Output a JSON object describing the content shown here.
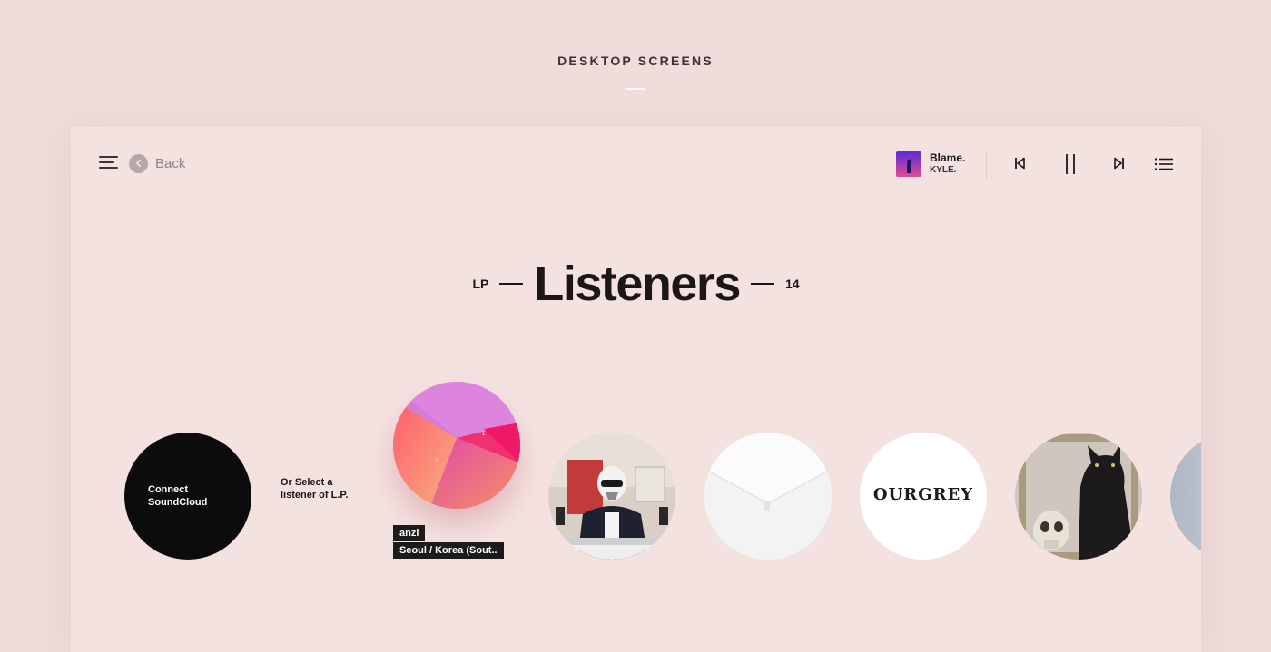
{
  "page": {
    "heading": "DESKTOP SCREENS"
  },
  "topbar": {
    "back_label": "Back",
    "now_playing": {
      "title": "Blame.",
      "artist": "KYLE."
    }
  },
  "title": {
    "prefix": "LP",
    "main": "Listeners",
    "count": "14"
  },
  "connect": {
    "label": "Connect SoundCloud"
  },
  "select_hint": "Or Select a listener of L.P.",
  "featured": {
    "name": "anzi",
    "location": "Seoul / Korea (Sout..",
    "chart_numbers": [
      "1",
      "2"
    ]
  },
  "listeners": [
    {
      "kind": "photo-stormtrooper"
    },
    {
      "kind": "white-abstract"
    },
    {
      "kind": "logo",
      "text": "OURGREY"
    },
    {
      "kind": "photo-cat"
    },
    {
      "kind": "partial"
    }
  ],
  "colors": {
    "background": "#f1dcdb",
    "panel": "#f4e2e1",
    "text": "#1b1717",
    "accent_pink": "#e6007e",
    "accent_orange": "#f59a6a"
  },
  "icons": [
    "menu-icon",
    "back-arrow-icon",
    "skip-previous-icon",
    "pause-icon",
    "skip-next-icon",
    "queue-list-icon"
  ]
}
